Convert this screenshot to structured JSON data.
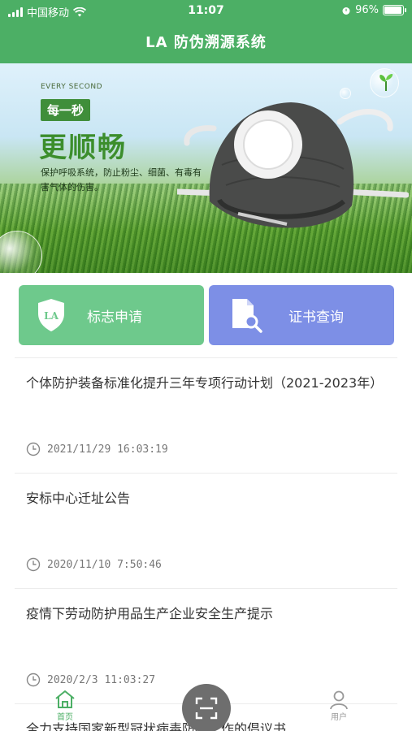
{
  "status_bar": {
    "carrier": "中国移动",
    "time": "11:07",
    "battery": "96%",
    "battery_level": 0.96
  },
  "nav": {
    "title": "LA 防伪溯源系统"
  },
  "banner": {
    "tag_en": "EVERY SECOND",
    "badge": "每一秒",
    "headline": "更顺畅",
    "description": "保护呼吸系统，防止粉尘、细菌、有毒有害气体的伤害。"
  },
  "actions": {
    "apply": {
      "label": "标志申请",
      "icon_text": "LA",
      "icon": "shield-icon"
    },
    "query": {
      "label": "证书查询",
      "icon": "document-search-icon"
    }
  },
  "news": [
    {
      "title": "个体防护装备标准化提升三年专项行动计划（2021-2023年）",
      "time": "2021/11/29 16:03:19"
    },
    {
      "title": "安标中心迁址公告",
      "time": "2020/11/10 7:50:46"
    },
    {
      "title": "疫情下劳动防护用品生产企业安全生产提示",
      "time": "2020/2/3 11:03:27"
    },
    {
      "title": "全力支持国家新型冠状病毒防疫工作的倡议书",
      "time": ""
    }
  ],
  "tabbar": {
    "home_label": "首页",
    "user_label": "用户",
    "accent": "#4caf65"
  },
  "colors": {
    "primary": "#4caf65",
    "apply_button": "#6ec98c",
    "query_button": "#7d8fe6"
  }
}
